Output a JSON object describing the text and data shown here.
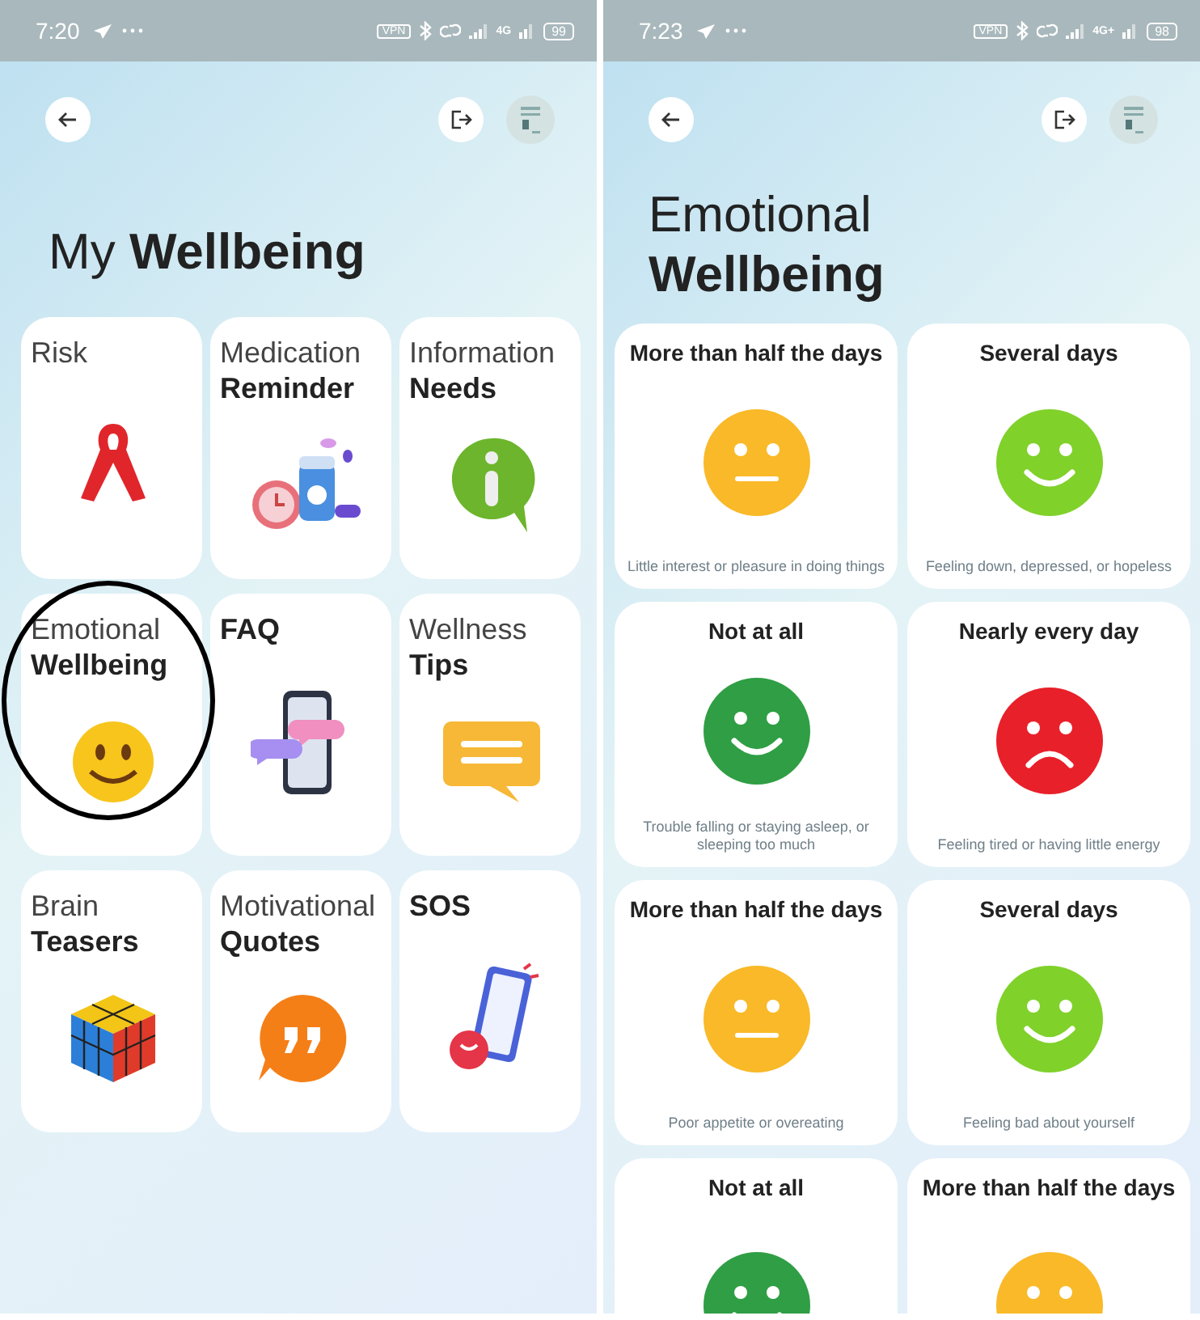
{
  "screens": [
    {
      "status_bar": {
        "time": "7:20",
        "vpn": "VPN",
        "network": "4G",
        "battery": "99"
      },
      "title": "My **Wellbeing**",
      "tiles": [
        {
          "light": "Risk",
          "highlighted": false
        },
        {
          "light": "Medication",
          "bold": "Reminder",
          "highlighted": false
        },
        {
          "light": "Information",
          "bold": "Needs",
          "highlighted": false
        },
        {
          "light": "Emotional",
          "bold": "Wellbeing",
          "highlighted": true
        },
        {
          "bold": "FAQ",
          "highlighted": false
        },
        {
          "light": "Wellness",
          "bold": "Tips",
          "highlighted": false
        },
        {
          "light": "Brain",
          "bold": "Teasers",
          "highlighted": false
        },
        {
          "light": "Motivational",
          "bold": "Quotes",
          "highlighted": false
        },
        {
          "bold": "SOS",
          "highlighted": false
        }
      ]
    },
    {
      "status_bar": {
        "time": "7:23",
        "vpn": "VPN",
        "network": "4G+",
        "battery": "98"
      },
      "title_light": "Emotional",
      "title_bold": "Wellbeing",
      "cards": [
        {
          "answer": "More than half the days",
          "kind": "neutral",
          "color": "#f9b928",
          "question": "Little interest or pleasure in doing things"
        },
        {
          "answer": "Several days",
          "kind": "happy",
          "color": "#80d12a",
          "question": "Feeling down, depressed, or hopeless"
        },
        {
          "answer": "Not at all",
          "kind": "happy",
          "color": "#2f9e44",
          "question": "Trouble falling or staying asleep, or sleeping too much"
        },
        {
          "answer": "Nearly every day",
          "kind": "sad",
          "color": "#e8202a",
          "question": "Feeling tired or having little energy"
        },
        {
          "answer": "More than half the days",
          "kind": "neutral",
          "color": "#f9b928",
          "question": "Poor appetite or overeating"
        },
        {
          "answer": "Several days",
          "kind": "happy",
          "color": "#80d12a",
          "question": "Feeling bad about yourself"
        },
        {
          "answer": "Not at all",
          "kind": "happy",
          "color": "#2f9e44"
        },
        {
          "answer": "More than half the days",
          "kind": "neutral",
          "color": "#f9b928"
        }
      ]
    }
  ]
}
